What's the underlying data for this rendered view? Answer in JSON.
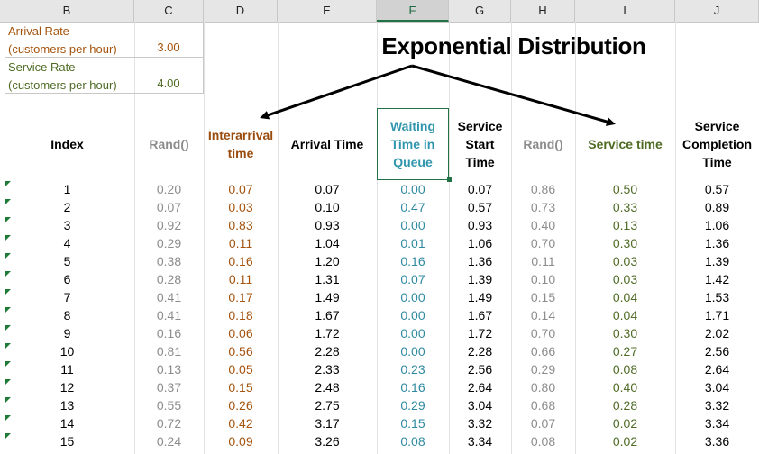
{
  "column_headers": [
    "B",
    "C",
    "D",
    "E",
    "F",
    "G",
    "H",
    "I",
    "J"
  ],
  "selected_column": "F",
  "parameters": [
    {
      "label": "Arrival Rate\n(customers per hour)",
      "value": "3.00",
      "color": "#a5540e"
    },
    {
      "label": "Service Rate\n(customers per hour)",
      "value": "4.00",
      "color": "#4f6b25"
    }
  ],
  "title": "Exponential Distribution",
  "headers": [
    {
      "text": "Index",
      "color": "#000000"
    },
    {
      "text": "Rand()",
      "color": "#8c8c8c"
    },
    {
      "text": "Interarrival\ntime",
      "color": "#9a4c0e"
    },
    {
      "text": "Arrival Time",
      "color": "#000000"
    },
    {
      "text": "Waiting\nTime in\nQueue",
      "color": "#3196ad"
    },
    {
      "text": "Service\nStart\nTime",
      "color": "#000000"
    },
    {
      "text": "Rand()",
      "color": "#8c8c8c"
    },
    {
      "text": "Service time",
      "color": "#4e6b22"
    },
    {
      "text": "Service\nCompletion\nTime",
      "color": "#000000"
    }
  ],
  "rows": [
    [
      "1",
      "0.20",
      "0.07",
      "0.07",
      "0.00",
      "0.07",
      "0.86",
      "0.50",
      "0.57"
    ],
    [
      "2",
      "0.07",
      "0.03",
      "0.10",
      "0.47",
      "0.57",
      "0.73",
      "0.33",
      "0.89"
    ],
    [
      "3",
      "0.92",
      "0.83",
      "0.93",
      "0.00",
      "0.93",
      "0.40",
      "0.13",
      "1.06"
    ],
    [
      "4",
      "0.29",
      "0.11",
      "1.04",
      "0.01",
      "1.06",
      "0.70",
      "0.30",
      "1.36"
    ],
    [
      "5",
      "0.38",
      "0.16",
      "1.20",
      "0.16",
      "1.36",
      "0.11",
      "0.03",
      "1.39"
    ],
    [
      "6",
      "0.28",
      "0.11",
      "1.31",
      "0.07",
      "1.39",
      "0.10",
      "0.03",
      "1.42"
    ],
    [
      "7",
      "0.41",
      "0.17",
      "1.49",
      "0.00",
      "1.49",
      "0.15",
      "0.04",
      "1.53"
    ],
    [
      "8",
      "0.41",
      "0.18",
      "1.67",
      "0.00",
      "1.67",
      "0.14",
      "0.04",
      "1.71"
    ],
    [
      "9",
      "0.16",
      "0.06",
      "1.72",
      "0.00",
      "1.72",
      "0.70",
      "0.30",
      "2.02"
    ],
    [
      "10",
      "0.81",
      "0.56",
      "2.28",
      "0.00",
      "2.28",
      "0.66",
      "0.27",
      "2.56"
    ],
    [
      "11",
      "0.13",
      "0.05",
      "2.33",
      "0.23",
      "2.56",
      "0.29",
      "0.08",
      "2.64"
    ],
    [
      "12",
      "0.37",
      "0.15",
      "2.48",
      "0.16",
      "2.64",
      "0.80",
      "0.40",
      "3.04"
    ],
    [
      "13",
      "0.55",
      "0.26",
      "2.75",
      "0.29",
      "3.04",
      "0.68",
      "0.28",
      "3.32"
    ],
    [
      "14",
      "0.72",
      "0.42",
      "3.17",
      "0.15",
      "3.32",
      "0.07",
      "0.02",
      "3.34"
    ],
    [
      "15",
      "0.24",
      "0.09",
      "3.26",
      "0.08",
      "3.34",
      "0.08",
      "0.02",
      "3.36"
    ]
  ]
}
